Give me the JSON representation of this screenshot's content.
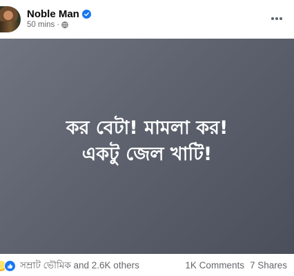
{
  "post": {
    "author": "Noble Man",
    "verified": true,
    "time": "50 mins",
    "separator": "·",
    "privacy_icon": "globe-icon",
    "more_icon": "more-options-icon",
    "text_lines": [
      "কর বেটা! মামলা কর!",
      "একটু জেল খাটি!"
    ],
    "background_colors": [
      "#6f7480",
      "#4b4f5b"
    ]
  },
  "footer": {
    "reaction_icons": [
      "haha-icon",
      "like-icon"
    ],
    "reactions_text": "সম্রাট ভৌমিক and 2.6K others",
    "comments": "1K Comments",
    "shares": "7 Shares"
  },
  "colors": {
    "brand_blue": "#1877f2",
    "secondary_text": "#65676b",
    "primary_text": "#050505"
  }
}
